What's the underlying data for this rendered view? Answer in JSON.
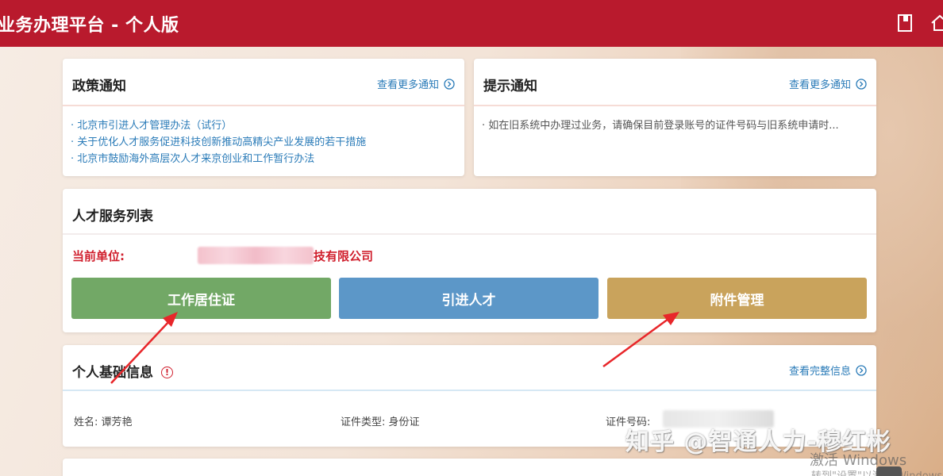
{
  "header": {
    "title": "业务办理平台 - 个人版",
    "icons": [
      "book-icon",
      "home-icon"
    ]
  },
  "policy_notice": {
    "title": "政策通知",
    "more_label": "查看更多通知",
    "items": [
      "· 北京市引进人才管理办法（试行）",
      "· 关于优化人才服务促进科技创新推动高精尖产业发展的若干措施",
      "· 北京市鼓励海外高层次人才来京创业和工作暂行办法"
    ]
  },
  "tip_notice": {
    "title": "提示通知",
    "more_label": "查看更多通知",
    "items": [
      "· 如在旧系统中办理过业务，请确保目前登录账号的证件号码与旧系统申请时..."
    ]
  },
  "talent_service": {
    "title": "人才服务列表",
    "unit_label": "当前单位:",
    "unit_suffix": "技有限公司",
    "buttons": [
      {
        "label": "工作居住证",
        "color": "#72a866"
      },
      {
        "label": "引进人才",
        "color": "#5c97c8"
      },
      {
        "label": "附件管理",
        "color": "#c9a35c"
      }
    ]
  },
  "personal_info": {
    "title": "个人基础信息",
    "more_label": "查看完整信息",
    "name_label": "姓名:",
    "name_value": "谭芳艳",
    "id_type_label": "证件类型:",
    "id_type_value": "身份证",
    "id_number_label": "证件号码:"
  },
  "watermark": "知乎 @智通人力-穆红彬",
  "windows_activate": "激活 Windows",
  "windows_activate_sub": "转到\"设置\"以激活 Windows",
  "colors": {
    "header": "#b91a2d",
    "link": "#2a7bb8",
    "accent_red": "#d01f2d",
    "arrow": "#e8262a"
  }
}
